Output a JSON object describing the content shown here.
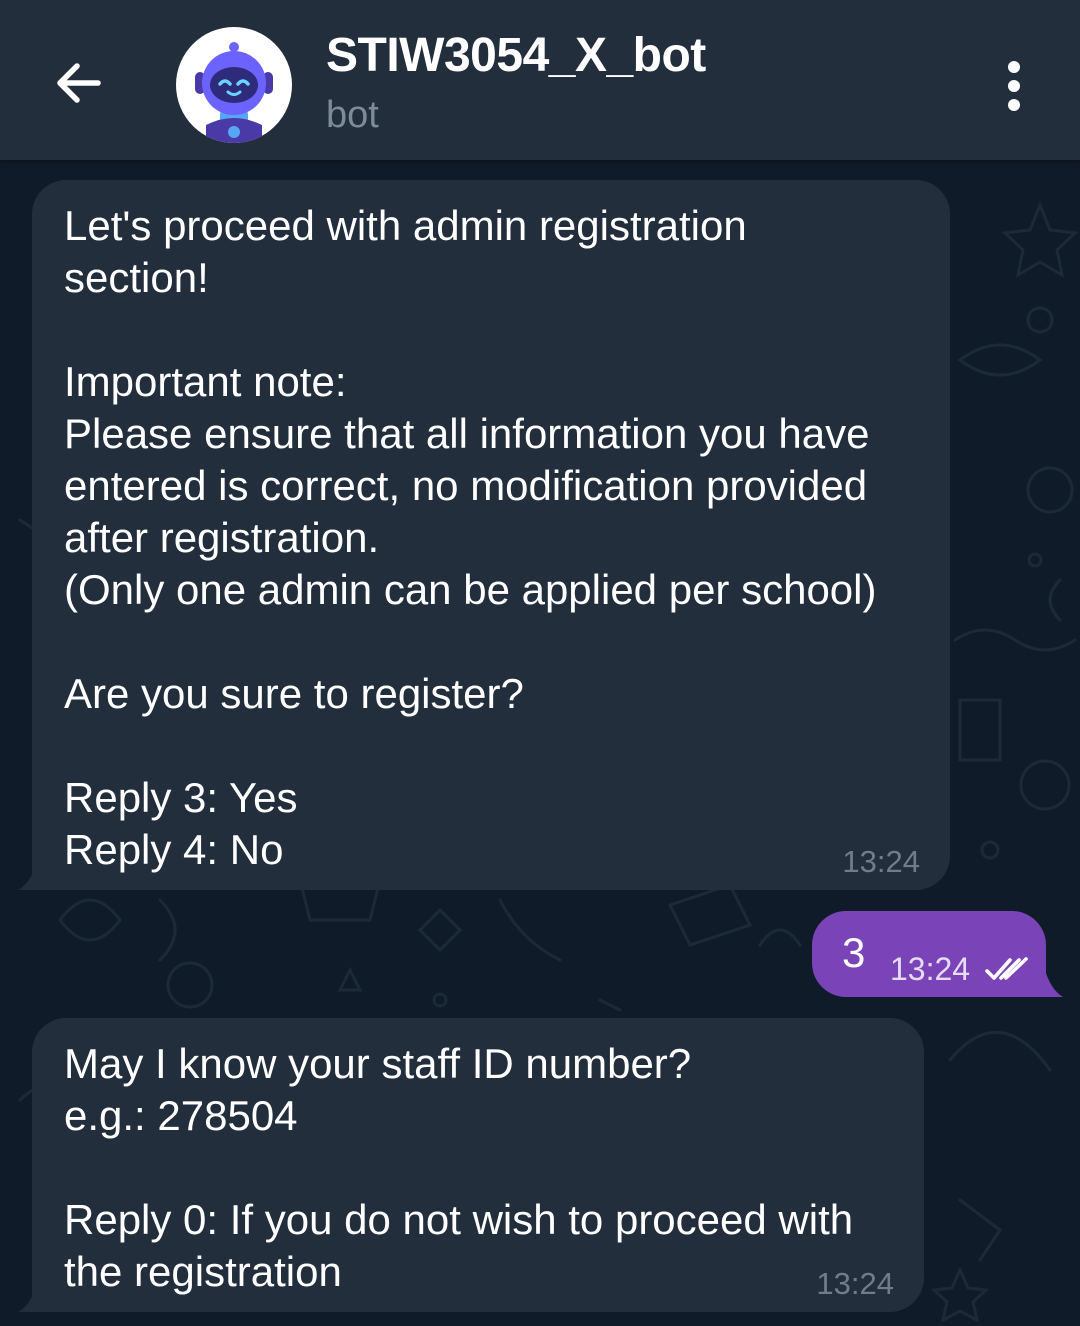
{
  "header": {
    "title": "STIW3054_X_bot",
    "subtitle": "bot",
    "back_icon": "arrow-left-icon",
    "menu_icon": "more-vertical-icon",
    "avatar_icon": "robot-avatar-icon"
  },
  "messages": [
    {
      "direction": "incoming",
      "text": "Let's proceed with admin registration\nsection!\n\nImportant note:\nPlease ensure that all information you have\nentered is correct, no modification provided\nafter registration.\n(Only one admin can be applied per school)\n\nAre you sure to register?\n\nReply 3: Yes\nReply 4: No",
      "time": "13:24"
    },
    {
      "direction": "outgoing",
      "text": "3",
      "time": "13:24",
      "status_icon": "double-check-icon"
    },
    {
      "direction": "incoming",
      "text": "May I know your staff ID number?\ne.g.: 278504\n\nReply 0: If you do not wish to proceed with\nthe registration",
      "time": "13:24"
    }
  ],
  "colors": {
    "background": "#0f1b28",
    "header": "#232e3c",
    "incoming_bubble": "#232e3c",
    "outgoing_bubble": "#7a44b8",
    "subtitle": "#7d8b99"
  }
}
